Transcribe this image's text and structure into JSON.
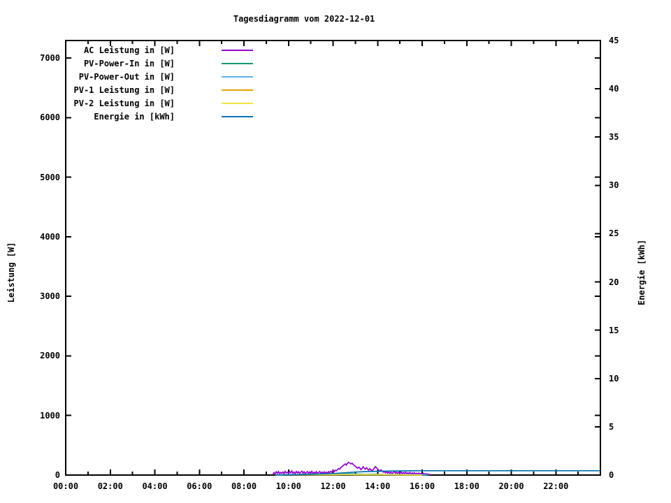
{
  "title": "Tagesdiagramm vom 2022-12-01",
  "background": "#ffffff",
  "chart_data": {
    "type": "line",
    "title": "Tagesdiagramm vom 2022-12-01",
    "grid": false,
    "legend_position": "top-left-inside",
    "xlim": [
      0,
      24
    ],
    "x_axis": {
      "unit": "time",
      "major_tick_hours": 2,
      "minor_tick_hours": 1,
      "ticks": [
        {
          "h": 0,
          "label": "00:00"
        },
        {
          "h": 2,
          "label": "02:00"
        },
        {
          "h": 4,
          "label": "04:00"
        },
        {
          "h": 6,
          "label": "06:00"
        },
        {
          "h": 8,
          "label": "08:00"
        },
        {
          "h": 10,
          "label": "10:00"
        },
        {
          "h": 12,
          "label": "12:00"
        },
        {
          "h": 14,
          "label": "14:00"
        },
        {
          "h": 16,
          "label": "16:00"
        },
        {
          "h": 18,
          "label": "18:00"
        },
        {
          "h": 20,
          "label": "20:00"
        },
        {
          "h": 22,
          "label": "22:00"
        }
      ]
    },
    "y_axis": {
      "label": "Leistung [W]",
      "lim": [
        0,
        7293
      ],
      "tick_step": 1000,
      "ticks": [
        {
          "v": 0,
          "label": "0"
        },
        {
          "v": 1000,
          "label": "1000"
        },
        {
          "v": 2000,
          "label": "2000"
        },
        {
          "v": 3000,
          "label": "3000"
        },
        {
          "v": 4000,
          "label": "4000"
        },
        {
          "v": 5000,
          "label": "5000"
        },
        {
          "v": 6000,
          "label": "6000"
        },
        {
          "v": 7000,
          "label": "7000"
        }
      ]
    },
    "y2_axis": {
      "label": "Energie [kWh]",
      "lim": [
        0,
        45
      ],
      "tick_step": 5,
      "ticks": [
        {
          "v": 0,
          "label": "0"
        },
        {
          "v": 5,
          "label": "5"
        },
        {
          "v": 10,
          "label": "10"
        },
        {
          "v": 15,
          "label": "15"
        },
        {
          "v": 20,
          "label": "20"
        },
        {
          "v": 25,
          "label": "25"
        },
        {
          "v": 30,
          "label": "30"
        },
        {
          "v": 35,
          "label": "35"
        },
        {
          "v": 40,
          "label": "40"
        },
        {
          "v": 45,
          "label": "45"
        }
      ]
    },
    "series": [
      {
        "id": "ac",
        "name": "AC Leistung in [W]",
        "color": "#9400D3",
        "axis": "y1",
        "points": [
          [
            9.3,
            18
          ],
          [
            9.35,
            42
          ],
          [
            9.4,
            15
          ],
          [
            9.45,
            55
          ],
          [
            9.5,
            28
          ],
          [
            9.55,
            60
          ],
          [
            9.6,
            22
          ],
          [
            9.65,
            45
          ],
          [
            9.7,
            30
          ],
          [
            9.75,
            52
          ],
          [
            9.8,
            20
          ],
          [
            9.85,
            62
          ],
          [
            9.9,
            35
          ],
          [
            9.95,
            48
          ],
          [
            10.0,
            25
          ],
          [
            10.05,
            58
          ],
          [
            10.1,
            38
          ],
          [
            10.15,
            68
          ],
          [
            10.2,
            28
          ],
          [
            10.25,
            50
          ],
          [
            10.3,
            22
          ],
          [
            10.35,
            60
          ],
          [
            10.4,
            35
          ],
          [
            10.45,
            55
          ],
          [
            10.5,
            25
          ],
          [
            10.55,
            48
          ],
          [
            10.6,
            65
          ],
          [
            10.65,
            32
          ],
          [
            10.7,
            55
          ],
          [
            10.75,
            22
          ],
          [
            10.8,
            45
          ],
          [
            10.85,
            60
          ],
          [
            10.9,
            28
          ],
          [
            10.95,
            50
          ],
          [
            11.0,
            35
          ],
          [
            11.05,
            62
          ],
          [
            11.1,
            25
          ],
          [
            11.15,
            48
          ],
          [
            11.2,
            32
          ],
          [
            11.25,
            58
          ],
          [
            11.3,
            22
          ],
          [
            11.35,
            45
          ],
          [
            11.4,
            60
          ],
          [
            11.45,
            30
          ],
          [
            11.5,
            50
          ],
          [
            11.55,
            26
          ],
          [
            11.6,
            55
          ],
          [
            11.65,
            35
          ],
          [
            11.7,
            48
          ],
          [
            11.75,
            28
          ],
          [
            11.8,
            58
          ],
          [
            11.85,
            40
          ],
          [
            11.9,
            65
          ],
          [
            11.95,
            48
          ],
          [
            12.0,
            70
          ],
          [
            12.05,
            58
          ],
          [
            12.1,
            82
          ],
          [
            12.15,
            72
          ],
          [
            12.2,
            95
          ],
          [
            12.25,
            108
          ],
          [
            12.3,
            98
          ],
          [
            12.35,
            128
          ],
          [
            12.4,
            142
          ],
          [
            12.45,
            158
          ],
          [
            12.5,
            172
          ],
          [
            12.55,
            188
          ],
          [
            12.6,
            168
          ],
          [
            12.65,
            198
          ],
          [
            12.7,
            212
          ],
          [
            12.75,
            202
          ],
          [
            12.8,
            188
          ],
          [
            12.85,
            198
          ],
          [
            12.9,
            178
          ],
          [
            12.95,
            162
          ],
          [
            13.0,
            148
          ],
          [
            13.05,
            128
          ],
          [
            13.1,
            112
          ],
          [
            13.15,
            132
          ],
          [
            13.2,
            118
          ],
          [
            13.25,
            92
          ],
          [
            13.3,
            108
          ],
          [
            13.35,
            138
          ],
          [
            13.4,
            118
          ],
          [
            13.45,
            98
          ],
          [
            13.5,
            122
          ],
          [
            13.55,
            102
          ],
          [
            13.6,
            82
          ],
          [
            13.65,
            108
          ],
          [
            13.7,
            88
          ],
          [
            13.75,
            68
          ],
          [
            13.8,
            92
          ],
          [
            13.85,
            118
          ],
          [
            13.9,
            142
          ],
          [
            13.95,
            122
          ],
          [
            14.0,
            102
          ],
          [
            14.05,
            82
          ],
          [
            14.1,
            62
          ],
          [
            14.15,
            88
          ],
          [
            14.2,
            68
          ],
          [
            14.25,
            48
          ],
          [
            14.3,
            62
          ],
          [
            14.35,
            38
          ],
          [
            14.4,
            58
          ],
          [
            14.45,
            32
          ],
          [
            14.5,
            52
          ],
          [
            14.55,
            28
          ],
          [
            14.6,
            48
          ],
          [
            14.65,
            25
          ],
          [
            14.7,
            42
          ],
          [
            14.75,
            58
          ],
          [
            14.8,
            32
          ],
          [
            14.85,
            50
          ],
          [
            14.9,
            26
          ],
          [
            14.95,
            45
          ],
          [
            15.0,
            30
          ],
          [
            15.05,
            52
          ],
          [
            15.1,
            22
          ],
          [
            15.15,
            42
          ],
          [
            15.2,
            28
          ],
          [
            15.25,
            48
          ],
          [
            15.3,
            20
          ],
          [
            15.35,
            40
          ],
          [
            15.4,
            25
          ],
          [
            15.45,
            45
          ],
          [
            15.5,
            18
          ],
          [
            15.55,
            36
          ],
          [
            15.6,
            22
          ],
          [
            15.65,
            40
          ],
          [
            15.7,
            16
          ],
          [
            15.75,
            32
          ],
          [
            15.8,
            20
          ],
          [
            15.85,
            35
          ],
          [
            15.9,
            14
          ],
          [
            15.95,
            28
          ],
          [
            16.0,
            18
          ],
          [
            16.05,
            30
          ],
          [
            16.1,
            10
          ],
          [
            16.15,
            22
          ],
          [
            16.2,
            14
          ],
          [
            16.25,
            18
          ],
          [
            16.3,
            7
          ],
          [
            16.35,
            10
          ],
          [
            16.4,
            4
          ]
        ]
      },
      {
        "id": "pv_in",
        "name": "PV-Power-In in [W]",
        "color": "#009E73",
        "axis": "y1",
        "points": [
          [
            9.4,
            2
          ],
          [
            9.7,
            5
          ],
          [
            10.0,
            8
          ],
          [
            10.3,
            6
          ],
          [
            10.6,
            10
          ],
          [
            10.9,
            7
          ],
          [
            11.2,
            9
          ],
          [
            11.5,
            6
          ],
          [
            11.8,
            10
          ],
          [
            12.1,
            14
          ],
          [
            12.4,
            18
          ],
          [
            12.7,
            24
          ],
          [
            13.0,
            18
          ],
          [
            13.3,
            14
          ],
          [
            13.6,
            12
          ],
          [
            13.9,
            15
          ],
          [
            14.2,
            10
          ],
          [
            14.5,
            8
          ],
          [
            14.8,
            9
          ],
          [
            15.1,
            6
          ],
          [
            15.4,
            7
          ],
          [
            15.7,
            5
          ],
          [
            16.0,
            4
          ],
          [
            16.3,
            2
          ]
        ]
      },
      {
        "id": "pv_out",
        "name": "PV-Power-Out in [W]",
        "color": "#56B4E9",
        "axis": "y1",
        "points": [
          [
            9.4,
            1
          ],
          [
            9.8,
            4
          ],
          [
            10.2,
            6
          ],
          [
            10.6,
            5
          ],
          [
            11.0,
            7
          ],
          [
            11.4,
            5
          ],
          [
            11.8,
            8
          ],
          [
            12.2,
            11
          ],
          [
            12.6,
            16
          ],
          [
            13.0,
            12
          ],
          [
            13.4,
            10
          ],
          [
            13.8,
            11
          ],
          [
            14.2,
            8
          ],
          [
            14.6,
            6
          ],
          [
            15.0,
            5
          ],
          [
            15.4,
            5
          ],
          [
            15.8,
            3
          ],
          [
            16.2,
            2
          ]
        ]
      },
      {
        "id": "pv1",
        "name": "PV-1 Leistung in [W]",
        "color": "#E69F00",
        "axis": "y1",
        "points": [
          [
            9.5,
            1
          ],
          [
            10.0,
            3
          ],
          [
            10.5,
            4
          ],
          [
            11.0,
            4
          ],
          [
            11.5,
            4
          ],
          [
            12.0,
            6
          ],
          [
            12.5,
            9
          ],
          [
            13.0,
            7
          ],
          [
            13.5,
            6
          ],
          [
            14.0,
            6
          ],
          [
            14.5,
            4
          ],
          [
            15.0,
            3
          ],
          [
            15.5,
            2
          ],
          [
            16.0,
            1
          ]
        ]
      },
      {
        "id": "pv2",
        "name": "PV-2 Leistung in [W]",
        "color": "#F0E442",
        "axis": "y1",
        "points": [
          [
            9.5,
            1
          ],
          [
            10.0,
            2
          ],
          [
            10.5,
            3
          ],
          [
            11.0,
            3
          ],
          [
            11.5,
            3
          ],
          [
            12.0,
            5
          ],
          [
            12.5,
            8
          ],
          [
            13.0,
            6
          ],
          [
            13.5,
            5
          ],
          [
            14.0,
            5
          ],
          [
            14.5,
            3
          ],
          [
            15.0,
            2
          ],
          [
            15.5,
            2
          ],
          [
            16.0,
            1
          ]
        ]
      },
      {
        "id": "energie",
        "name": "Energie in [kWh]",
        "color": "#0072B2",
        "axis": "y2",
        "points": [
          [
            9.4,
            0
          ],
          [
            10.0,
            0.02
          ],
          [
            10.5,
            0.05
          ],
          [
            11.0,
            0.08
          ],
          [
            11.5,
            0.12
          ],
          [
            12.0,
            0.16
          ],
          [
            12.5,
            0.23
          ],
          [
            13.0,
            0.31
          ],
          [
            13.5,
            0.36
          ],
          [
            14.0,
            0.39
          ],
          [
            14.5,
            0.42
          ],
          [
            15.0,
            0.43
          ],
          [
            15.5,
            0.44
          ],
          [
            16.0,
            0.45
          ],
          [
            16.5,
            0.45
          ],
          [
            24.0,
            0.45
          ]
        ]
      }
    ],
    "frame_color": "#000000"
  }
}
